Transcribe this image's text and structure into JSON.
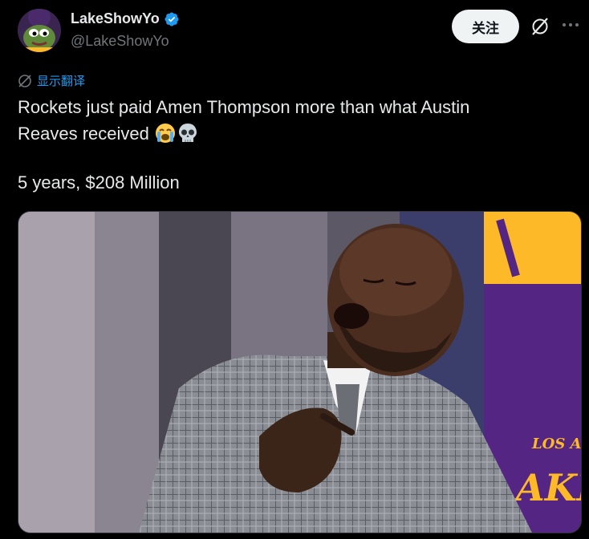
{
  "author": {
    "display_name": "LakeShowYo",
    "handle": "@LakeShowYo",
    "verified": true,
    "avatar_icon": "frog-avatar-icon"
  },
  "actions": {
    "follow_label": "关注",
    "grok_icon": "grok-icon",
    "more_icon": "more-horizontal-icon"
  },
  "translate": {
    "label": "显示翻译",
    "icon": "translate-globe-icon"
  },
  "tweet": {
    "text_line1": "Rockets just paid Amen Thompson more than what Austin",
    "text_line2": "Reaves received",
    "emojis": [
      "loudly-crying-face-emoji",
      "skull-emoji"
    ],
    "stats_line": "5 years, $208 Million"
  },
  "media": {
    "description_icon": "tweet-media-image",
    "overlay_logo_text": "LOS ANGELES LAKERS"
  },
  "colors": {
    "background": "#000000",
    "text": "#e7e9ea",
    "secondary": "#71767b",
    "link": "#1d9bf0",
    "verified": "#1d9bf0",
    "lakers_gold": "#fdb927",
    "lakers_purple": "#552583"
  }
}
